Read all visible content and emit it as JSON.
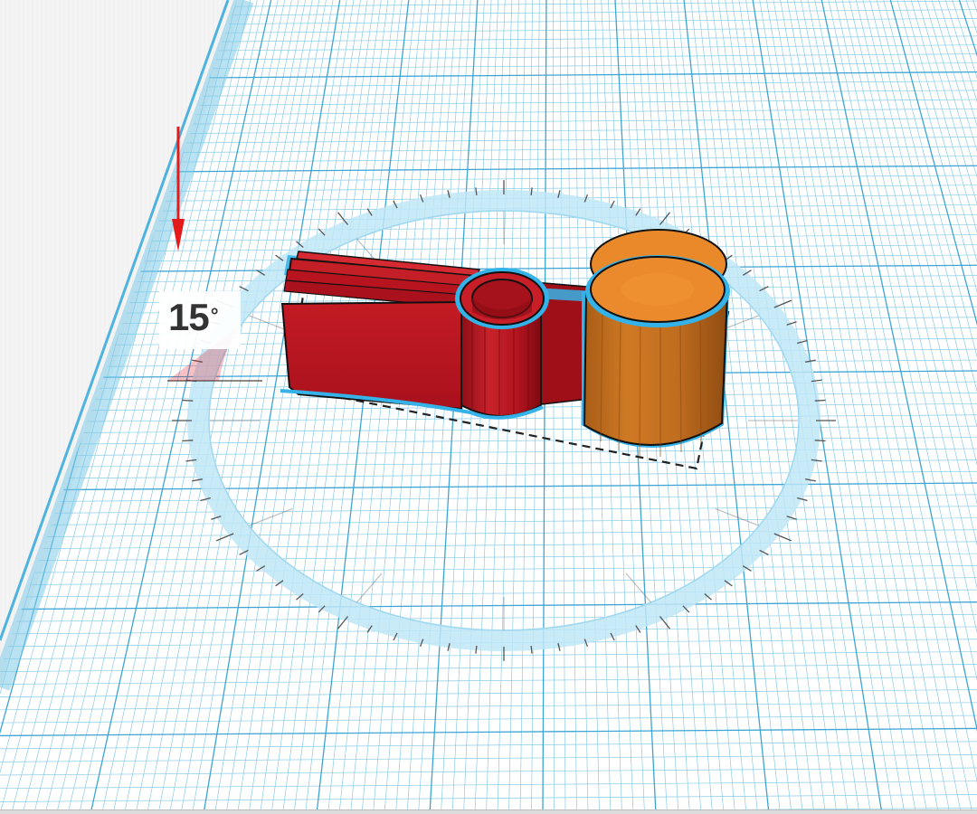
{
  "workplane": {
    "name": "workplane-grid",
    "grid_color": "#5fb6db",
    "major_line_color": "#3ea4d4",
    "edge_color": "#7fcbe8",
    "background_color": "#f4f4f4"
  },
  "rotation": {
    "angle_value": "15",
    "angle_unit": "°",
    "ring_color": "#bfe6f6",
    "tick_color": "#555555"
  },
  "annotation": {
    "arrow_color": "#e31b1b"
  },
  "selection": {
    "outline_color": "#35b3e8",
    "shapes": [
      {
        "name": "red-clip-body",
        "color": "#b8141f"
      },
      {
        "name": "orange-cylinder",
        "color": "#e9892a"
      }
    ]
  }
}
